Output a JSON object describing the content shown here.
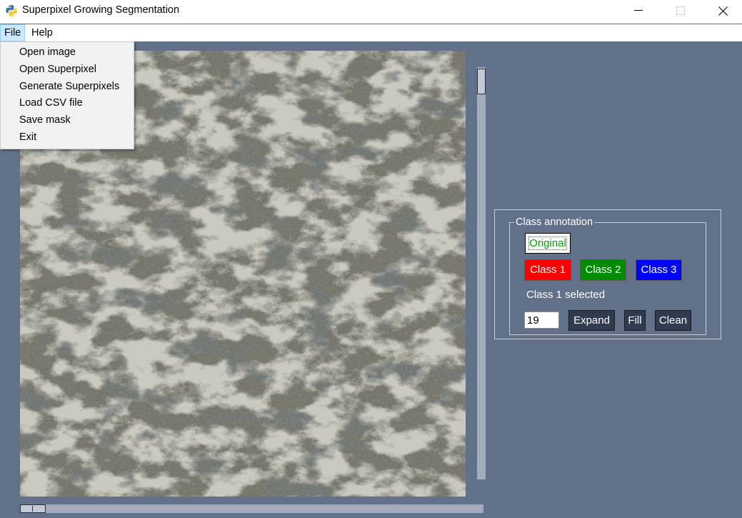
{
  "window": {
    "title": "Superpixel Growing Segmentation"
  },
  "menubar": {
    "file_label": "File",
    "help_label": "Help"
  },
  "file_menu": {
    "items": [
      "Open image",
      "Open Superpixel",
      "Generate Superpixels",
      "Load CSV file",
      "Save mask",
      "Exit"
    ]
  },
  "panel": {
    "title": "Class annotation",
    "original_label": "Original",
    "class1_label": "Class 1",
    "class2_label": "Class 2",
    "class3_label": "Class 3",
    "status_text": "Class 1 selected",
    "size_value": "19",
    "expand_label": "Expand",
    "fill_label": "Fill",
    "clean_label": "Clean"
  },
  "colors": {
    "background": "#62718a",
    "class1": "#ff0000",
    "class2": "#008c00",
    "class3": "#0000ff",
    "original_text": "#00a000"
  },
  "icons": {
    "app": "python-icon",
    "minimize": "minimize-icon",
    "maximize": "maximize-icon",
    "close": "close-icon"
  }
}
